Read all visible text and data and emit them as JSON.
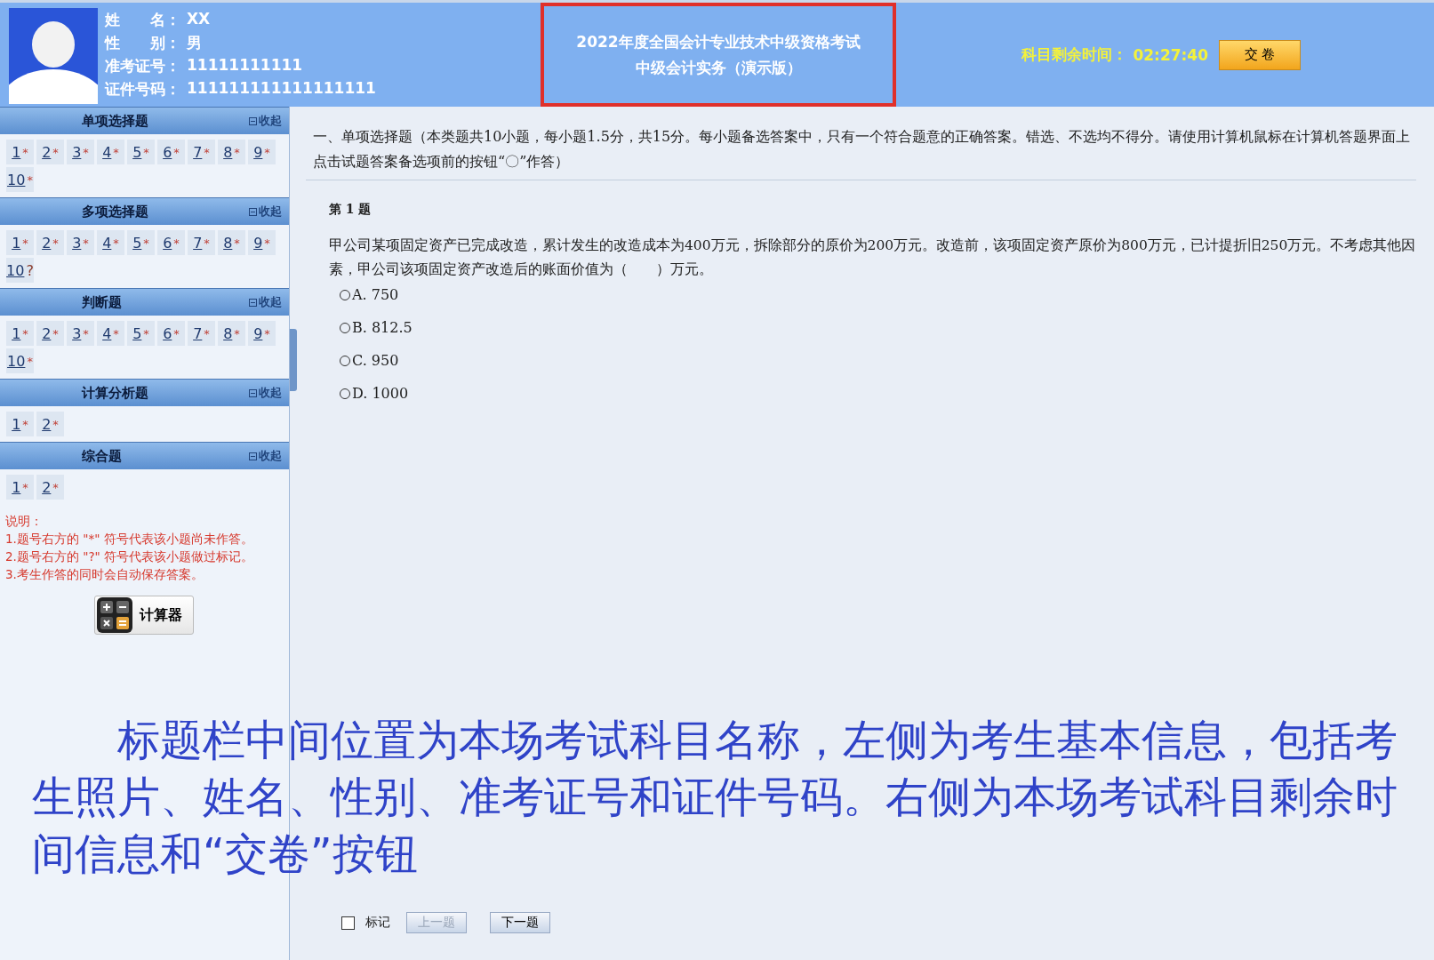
{
  "header": {
    "info": [
      {
        "label": "姓　　名：",
        "value": "XX"
      },
      {
        "label": "性　　别：",
        "value": "男"
      },
      {
        "label": "准考证号：",
        "value": "11111111111"
      },
      {
        "label": "证件号码：",
        "value": "111111111111111111"
      }
    ],
    "exam_title": [
      "2022年度全国会计专业技术中级资格考试",
      "中级会计实务（演示版）"
    ],
    "highlighted": true,
    "timer_label": "科目剩余时间：",
    "timer": "02:27:40",
    "submit": "交 卷"
  },
  "sidebar": {
    "sections": [
      {
        "title": "单项选择题",
        "collapse": "收起",
        "items": [
          {
            "num": "1",
            "mark": "*"
          },
          {
            "num": "2",
            "mark": "*"
          },
          {
            "num": "3",
            "mark": "*"
          },
          {
            "num": "4",
            "mark": "*"
          },
          {
            "num": "5",
            "mark": "*"
          },
          {
            "num": "6",
            "mark": "*"
          },
          {
            "num": "7",
            "mark": "*"
          },
          {
            "num": "8",
            "mark": "*"
          },
          {
            "num": "9",
            "mark": "*"
          },
          {
            "num": "10",
            "mark": "*"
          }
        ]
      },
      {
        "title": "多项选择题",
        "collapse": "收起",
        "items": [
          {
            "num": "1",
            "mark": "*"
          },
          {
            "num": "2",
            "mark": "*"
          },
          {
            "num": "3",
            "mark": "*"
          },
          {
            "num": "4",
            "mark": "*"
          },
          {
            "num": "5",
            "mark": "*"
          },
          {
            "num": "6",
            "mark": "*"
          },
          {
            "num": "7",
            "mark": "*"
          },
          {
            "num": "8",
            "mark": "*"
          },
          {
            "num": "9",
            "mark": "*"
          },
          {
            "num": "10",
            "mark": "?"
          }
        ]
      },
      {
        "title": "判断题",
        "collapse": "收起",
        "items": [
          {
            "num": "1",
            "mark": "*"
          },
          {
            "num": "2",
            "mark": "*"
          },
          {
            "num": "3",
            "mark": "*"
          },
          {
            "num": "4",
            "mark": "*"
          },
          {
            "num": "5",
            "mark": "*"
          },
          {
            "num": "6",
            "mark": "*"
          },
          {
            "num": "7",
            "mark": "*"
          },
          {
            "num": "8",
            "mark": "*"
          },
          {
            "num": "9",
            "mark": "*"
          },
          {
            "num": "10",
            "mark": "*"
          }
        ]
      },
      {
        "title": "计算分析题",
        "collapse": "收起",
        "items": [
          {
            "num": "1",
            "mark": "*"
          },
          {
            "num": "2",
            "mark": "*"
          }
        ]
      },
      {
        "title": "综合题",
        "collapse": "收起",
        "items": [
          {
            "num": "1",
            "mark": "*"
          },
          {
            "num": "2",
            "mark": "*"
          }
        ]
      }
    ],
    "notes": [
      "说明：",
      "1.题号右方的 \"*\" 符号代表该小题尚未作答。",
      "2.题号右方的 \"?\" 符号代表该小题做过标记。",
      "3.考生作答的同时会自动保存答案。"
    ],
    "calculator": "计算器"
  },
  "main": {
    "instructions": "一、单项选择题（本类题共10小题，每小题1.5分，共15分。每小题备选答案中，只有一个符合题意的正确答案。错选、不选均不得分。请使用计算机鼠标在计算机答题界面上点击试题答案备选项前的按钮“〇”作答）",
    "question_no": "第 1 题",
    "question": "甲公司某项固定资产已完成改造，累计发生的改造成本为400万元，拆除部分的原价为200万元。改造前，该项固定资产原价为800万元，已计提折旧250万元。不考虑其他因素，甲公司该项固定资产改造后的账面价值为（　　）万元。",
    "options": [
      {
        "text": "A. 750",
        "selected": false
      },
      {
        "text": "B. 812.5",
        "selected": false
      },
      {
        "text": "C. 950",
        "selected": false
      },
      {
        "text": "D. 1000",
        "selected": false
      }
    ],
    "mark": {
      "label": "标记",
      "checked": false
    },
    "buttons": [
      {
        "label": "上一题",
        "disabled": true
      },
      {
        "label": "下一题",
        "disabled": false
      }
    ]
  },
  "annotation": "标题栏中间位置为本场考试科目名称，左侧为考生基本信息，包括考生照片、姓名、性别、准考证号和证件号码。右侧为本场考试科目剩余时间信息和“交卷”按钮"
}
